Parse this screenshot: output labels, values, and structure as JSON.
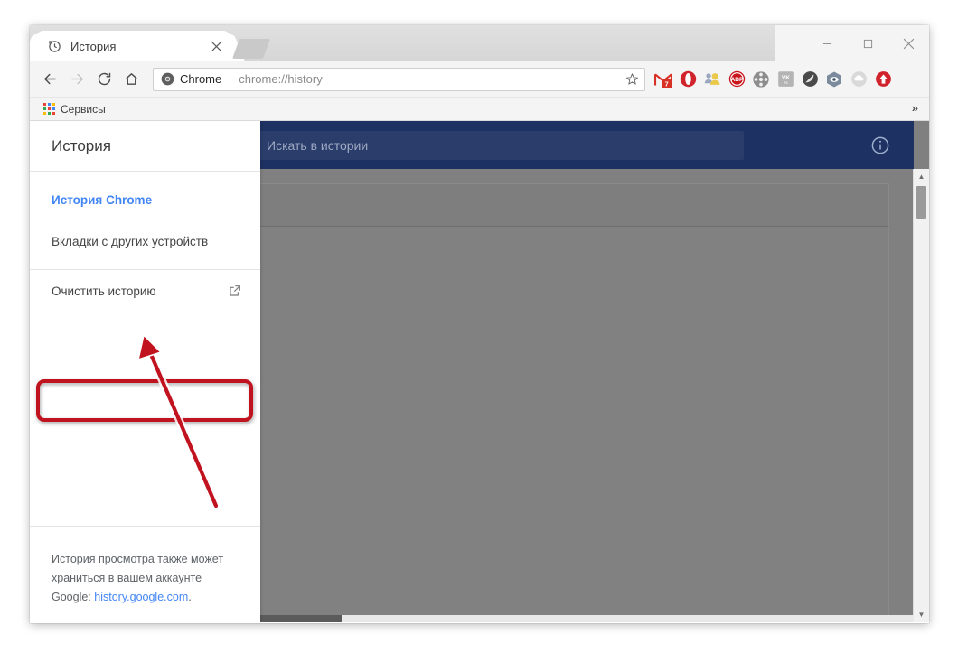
{
  "window": {
    "controls": {
      "minimize": "minimize-button",
      "maximize": "maximize-button",
      "close": "close-button"
    }
  },
  "tab": {
    "title": "История",
    "favicon": "history-clock-icon",
    "close": "×"
  },
  "toolbar": {
    "back": "back-icon",
    "forward": "forward-icon",
    "reload": "reload-icon",
    "home": "home-icon",
    "omnibox": {
      "scheme_label": "Chrome",
      "url": "chrome://history",
      "bookmark_star": "star-icon"
    },
    "extensions": [
      {
        "name": "gmail-extension",
        "badge": "7"
      },
      {
        "name": "opera-extension",
        "badge": ""
      },
      {
        "name": "people-extension",
        "badge": ""
      },
      {
        "name": "adblock-plus-extension",
        "label": "ABP",
        "badge": ""
      },
      {
        "name": "film-reel-extension",
        "badge": ""
      },
      {
        "name": "vk-extension",
        "label": "VK",
        "badge": ""
      },
      {
        "name": "dark-circle-extension",
        "badge": ""
      },
      {
        "name": "eye-extension",
        "badge": ""
      },
      {
        "name": "cloud-download-extension",
        "badge": ""
      },
      {
        "name": "upload-arrow-extension",
        "badge": ""
      }
    ]
  },
  "bookmarks": {
    "items": [
      {
        "label": "Сервисы",
        "icon": "apps-grid-icon"
      }
    ],
    "overflow": "»"
  },
  "history_page": {
    "search_placeholder": "Искать в истории",
    "search_value": "",
    "info_icon": "info-circle-icon",
    "toolbar_color": "#1d3263"
  },
  "sidebar": {
    "title": "История",
    "items": [
      {
        "label": "История Chrome",
        "active": true,
        "name": "sidebar-item-chrome-history"
      },
      {
        "label": "Вкладки с других устройств",
        "active": false,
        "name": "sidebar-item-other-devices"
      }
    ],
    "clear_item": {
      "label": "Очистить историю",
      "icon": "external-link-icon",
      "name": "sidebar-item-clear-history"
    },
    "footer": {
      "text_before": "История просмотра также может храниться в вашем аккаунте Google: ",
      "link": "history.google.com",
      "text_after": "."
    }
  },
  "annotations": {
    "highlight_color": "#c1121f",
    "highlight_target": "Очистить историю",
    "arrow": "red-pointer-arrow"
  },
  "scrollbars": {
    "vertical_up": "▲",
    "vertical_down": "▼"
  }
}
